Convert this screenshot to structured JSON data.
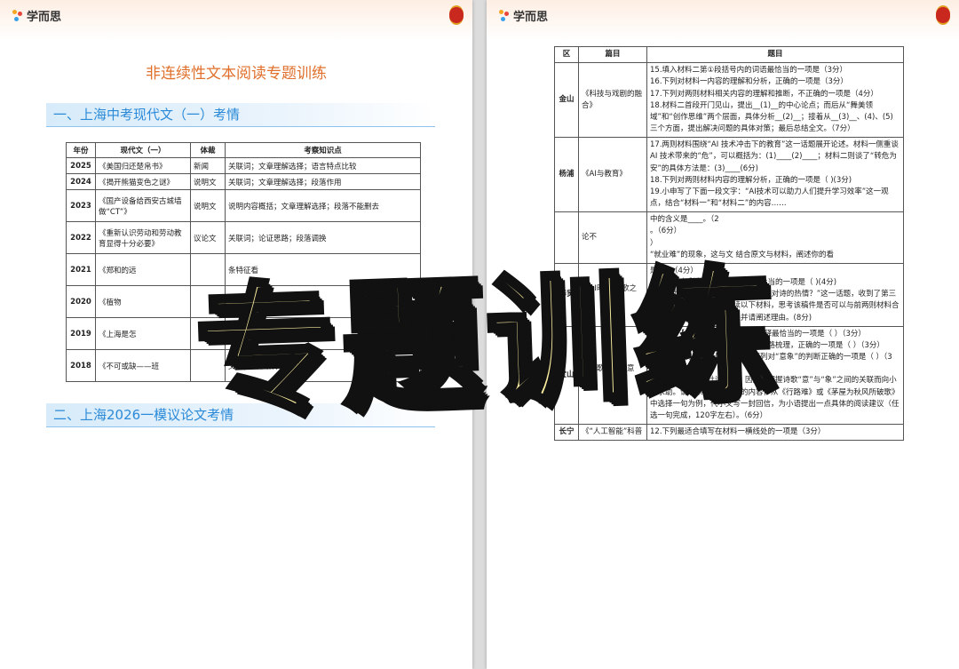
{
  "brand": {
    "name": "学而思"
  },
  "left_page": {
    "title": "非连续性文本阅读专题训练",
    "section1": "一、上海中考现代文（一）考情",
    "table": {
      "headers": [
        "年份",
        "现代文（一）",
        "体裁",
        "考察知识点"
      ],
      "rows": [
        [
          "2025",
          "《美国归还楚帛书》",
          "新闻",
          "关联词；文章理解选择；语言特点比较"
        ],
        [
          "2024",
          "《揭开熊猫变色之谜》",
          "说明文",
          "关联词；文章理解选择；段落作用"
        ],
        [
          "2023",
          "《国产设备给西安古城墙做“CT”》",
          "说明文",
          "说明内容概括；文章理解选择；段落不能删去"
        ],
        [
          "2022",
          "《重新认识劳动和劳动教育显得十分必要》",
          "议论文",
          "关联词；论证思路；段落调换"
        ],
        [
          "2021",
          "《郑和的远",
          "",
          "条特征看"
        ],
        [
          "2020",
          "《植物",
          "",
          "内容概"
        ],
        [
          "2019",
          "《上海是怎",
          "",
          "说"
        ],
        [
          "2018",
          "《不可或缺——班",
          "",
          "文字；文 其作用；"
        ]
      ]
    },
    "section2": "二、上海2026一模议论文考情"
  },
  "right_page": {
    "table": {
      "headers": [
        "区",
        "篇目",
        "题目"
      ],
      "rows": [
        {
          "district": "金山",
          "subject": "《科技与戏剧的融合》",
          "questions": [
            "15.填入材料二第①段括号内的词语最恰当的一项是（3分）",
            "16.下列对材料一内容的理解和分析，正确的一项是（3分）",
            "17.下列对两则材料相关内容的理解和推断，不正确的一项是（4分）",
            "18.材料二首段开门见山，提出__(1)__的中心论点；而后从“舞美领域”和“创作思维”两个层面，具体分析__(2)__；接着从__(3)__、(4)、(5)三个方面，提出解决问题的具体对策；最后总结全文。（7分）"
          ]
        },
        {
          "district": "杨浦",
          "subject": "《AI与教育》",
          "questions": [
            "17.两则材料围绕“AI 技术冲击下的教育”这一话题展开论述。材料一侧重谈AI 技术带来的“危”，可以概括为：(1)____(2)____；材料二则谈了“转危为安”的具体方法是：(3)____(6分)",
            "18.下列对两则材料内容的理解分析，正确的一项是（ )(3分)",
            "19.小申写了下面一段文字：“AI技术可以助力人们提升学习效率”这一观点，结合“材料一”和“材料二”的内容……"
          ]
        },
        {
          "district": "",
          "subject": "论不",
          "questions": [
            "中的含义是____。（2",
            "。（6分）",
            "）",
            "“就业难”的现象，这与文 结合原文与材料，阐述你的看"
          ]
        },
        {
          "district": "奉贤",
          "subject": "《AI时代,诗歌之道》",
          "questions": [
            "是（ )（4分）",
            "15.下列对【材料……】分析最不恰当的一项是（ )(4分)",
            "16.针对“AI时代，我们为何还要葆有对诗的热情？”这一话题，收到了第三位作者的来稿，请仔细阅读以下材料，思考该稿件是否可以与前两则材料合稿，成为一篇完整的文章？并请阐述理由。(8分)"
          ]
        },
        {
          "district": "宝山",
          "subject": "《诗歌风格与意象》",
          "questions": [
            "11.依据【材料一】，对“意象”的解释最恰当的一项是（ ）（3分）",
            "12.下列对【材料二】中画线句的思路梳理，正确的一项是（ ）（3分）",
            "13.根据【材料一】【材料二】，下列对“意象”的判断正确的一项是（ ）（3分）",
            "14.小语阅读李、杜诗歌时，因无法把握诗歌“意”与“象”之间的关联而向小文求助。请联系【材料三】的内容，从《行路难》或《茅屋为秋风所破歌》中选择一句为例，代小文写一封回信，为小语提出一点具体的阅读建议（任选一句完成，120字左右）。（6分）"
          ]
        },
        {
          "district": "长宁",
          "subject": "《“人工智能”科普",
          "questions": [
            "12.下列最适合填写在材料一横线处的一项是（3分）"
          ]
        }
      ]
    }
  },
  "overlay_text": "专题训练",
  "colors": {
    "accent_orange": "#e0702c",
    "section_blue": "#2b8ad8",
    "overlay_fill": "#fbeea0"
  }
}
